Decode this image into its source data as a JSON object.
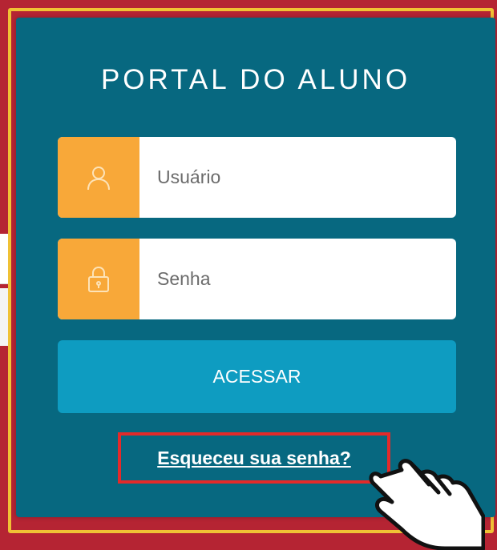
{
  "portal": {
    "title": "PORTAL DO ALUNO"
  },
  "login_form": {
    "username": {
      "placeholder": "Usuário",
      "icon": "user-icon",
      "value": ""
    },
    "password": {
      "placeholder": "Senha",
      "icon": "lock-icon",
      "value": ""
    },
    "submit_label": "ACESSAR",
    "forgot_password_label": "Esqueceu sua senha?"
  },
  "colors": {
    "page_background": "#b52433",
    "frame_border": "#f0c135",
    "card_background": "#076880",
    "icon_box": "#f8a839",
    "button": "#0e9cc1",
    "highlight_box": "#e32a2a"
  }
}
